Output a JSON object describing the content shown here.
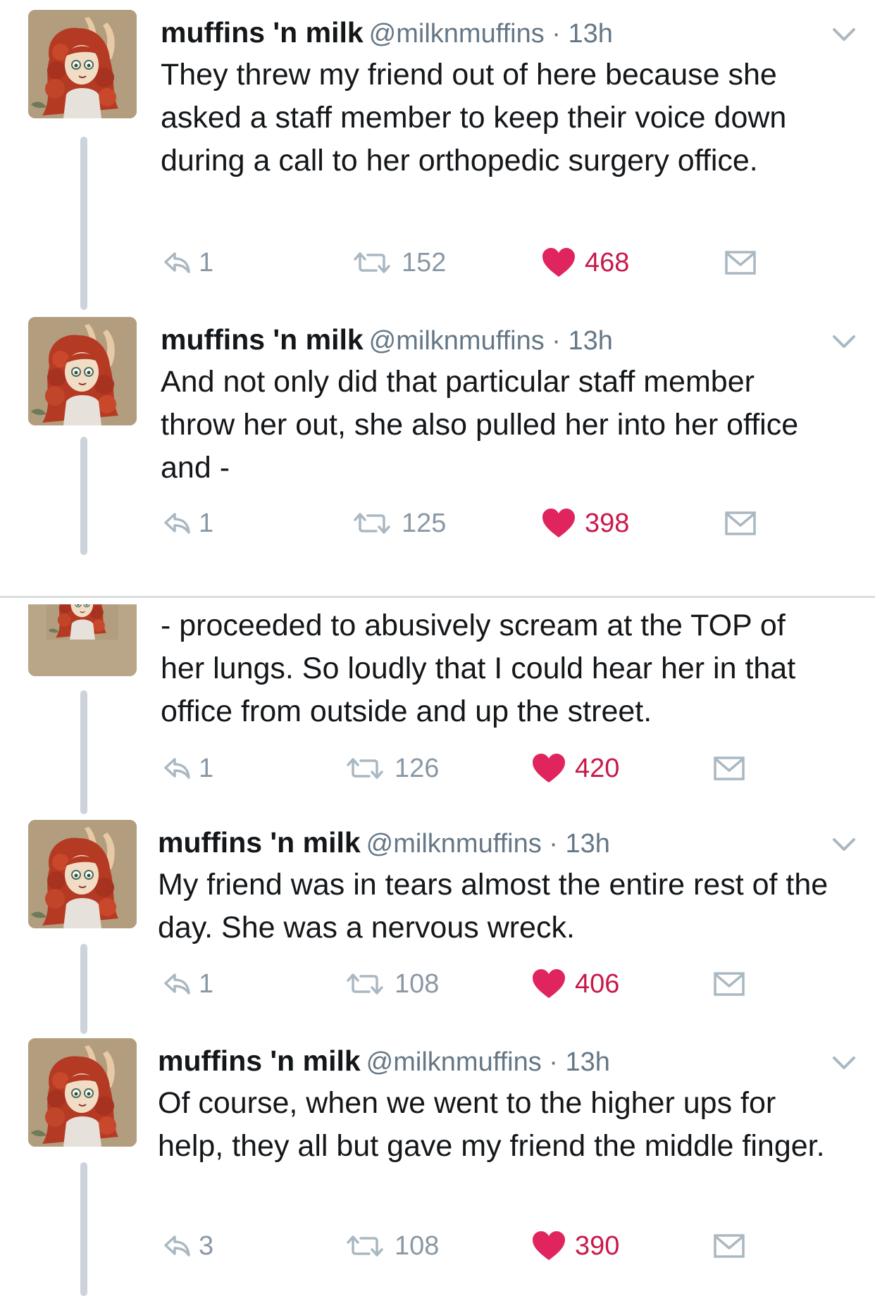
{
  "tweets": [
    {
      "name": "muffins 'n milk",
      "meta": "@milknmuffins · 13h",
      "text": "They threw my friend out of here because she asked a staff member to keep their voice down during a call to her orthopedic surgery office.",
      "replies": "1",
      "retweets": "152",
      "likes": "468"
    },
    {
      "name": "muffins 'n milk",
      "meta": "@milknmuffins · 13h",
      "text": "And not only did that particular staff member throw her out, she also pulled her into her office and -",
      "replies": "1",
      "retweets": "125",
      "likes": "398"
    },
    {
      "text": "- proceeded to abusively scream at the TOP of her lungs. So loudly that I could hear her in that office from outside and up the street.",
      "replies": "1",
      "retweets": "126",
      "likes": "420"
    },
    {
      "name": "muffins 'n milk",
      "meta": "@milknmuffins · 13h",
      "text": "My friend was in tears almost the entire rest of the day. She was a nervous wreck.",
      "replies": "1",
      "retweets": "108",
      "likes": "406"
    },
    {
      "name": "muffins 'n milk",
      "meta": "@milknmuffins · 13h",
      "text": "Of course, when we went to the higher ups for help, they all but gave my friend the middle finger.",
      "replies": "3",
      "retweets": "108",
      "likes": "390"
    }
  ],
  "icons": {
    "reply": "reply-icon",
    "retweet": "retweet-icon",
    "like": "heart-icon",
    "dm": "direct-message-icon",
    "caret": "chevron-down-icon"
  },
  "colors": {
    "like_active": "#e0245e",
    "muted": "#8a98a5",
    "thread_line": "#ccd3da"
  }
}
